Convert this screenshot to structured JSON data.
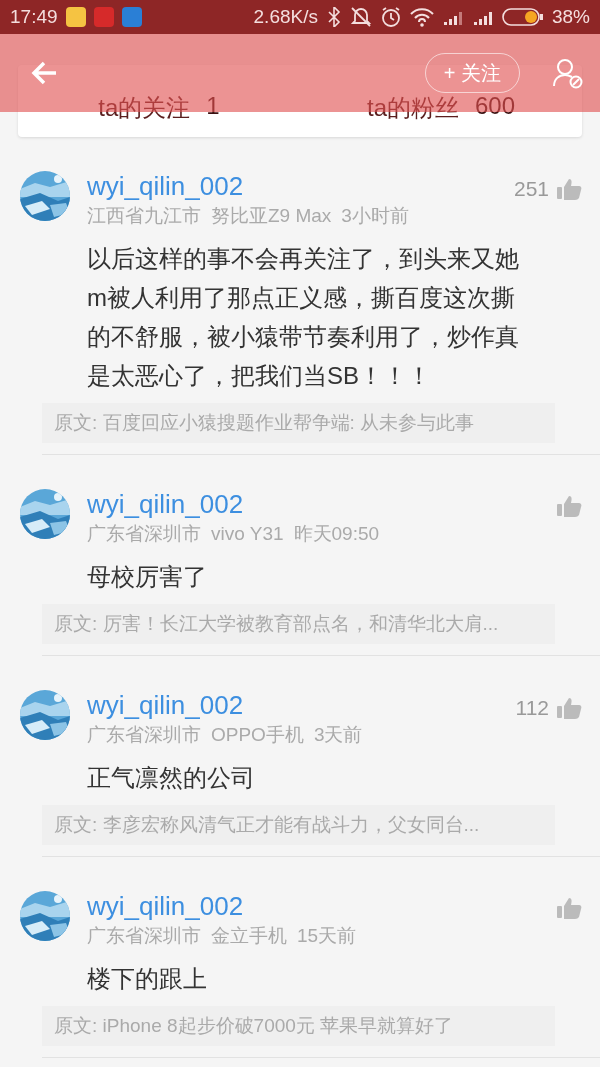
{
  "status_bar": {
    "time": "17:49",
    "speed": "2.68K/s",
    "battery": "38%"
  },
  "header": {
    "follow_button": "+ 关注"
  },
  "stats": [
    {
      "label": "ta的关注",
      "value": "1"
    },
    {
      "label": "ta的粉丝",
      "value": "600"
    }
  ],
  "comments": [
    {
      "user": "wyi_qilin_002",
      "location": "江西省九江市",
      "device": "努比亚Z9 Max",
      "time": "3小时前",
      "likes": "251",
      "text": "以后这样的事不会再关注了，到头来又她m被人利用了那点正义感，撕百度这次撕的不舒服，被小猿带节奏利用了，炒作真是太恶心了，把我们当SB！！！",
      "source": "原文: 百度回应小猿搜题作业帮争端: 从未参与此事"
    },
    {
      "user": "wyi_qilin_002",
      "location": "广东省深圳市",
      "device": "vivo Y31",
      "time": "昨天09:50",
      "text": "母校厉害了",
      "source": "原文: 厉害！长江大学被教育部点名，和清华北大肩..."
    },
    {
      "user": "wyi_qilin_002",
      "location": "广东省深圳市",
      "device": "OPPO手机",
      "time": "3天前",
      "likes": "112",
      "text": "正气凛然的公司",
      "source": "原文: 李彦宏称风清气正才能有战斗力，父女同台..."
    },
    {
      "user": "wyi_qilin_002",
      "location": "广东省深圳市",
      "device": "金立手机",
      "time": "15天前",
      "text": "楼下的跟上",
      "source": "原文: iPhone 8起步价破7000元 苹果早就算好了"
    }
  ]
}
